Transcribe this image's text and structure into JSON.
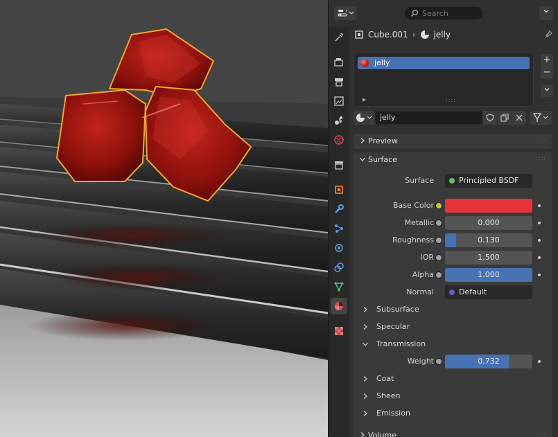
{
  "topbar": {
    "search_placeholder": "Search"
  },
  "context": {
    "object_name": "Cube.001",
    "material_name": "jelly"
  },
  "material_slots": {
    "items": [
      {
        "label": "jelly",
        "selected": true
      }
    ]
  },
  "material_selector": {
    "name": "jelly"
  },
  "panels": {
    "preview": {
      "label": "Preview"
    },
    "surface": {
      "label": "Surface",
      "properties": [
        {
          "label": "Surface",
          "value": "Principled BSDF",
          "socket_color": "#63c763"
        },
        {
          "label": "Base Color",
          "value": "",
          "color": "#e8323a",
          "socket_color": "#c7c729"
        },
        {
          "label": "Metallic",
          "value": "0.000",
          "fraction": 0.0,
          "socket_color": "#a1a1a1"
        },
        {
          "label": "Roughness",
          "value": "0.130",
          "fraction": 0.13,
          "socket_color": "#a1a1a1"
        },
        {
          "label": "IOR",
          "value": "1.500",
          "fraction": 0.0,
          "socket_color": "#a1a1a1"
        },
        {
          "label": "Alpha",
          "value": "1.000",
          "fraction": 1.0,
          "socket_color": "#a1a1a1"
        },
        {
          "label": "Normal",
          "value": "Default",
          "socket_color": "#6363c7"
        }
      ],
      "subpanels": [
        {
          "label": "Subsurface",
          "open": false
        },
        {
          "label": "Specular",
          "open": false
        },
        {
          "label": "Transmission",
          "open": true
        }
      ],
      "transmission": {
        "label": "Weight",
        "value": "0.732",
        "fraction": 0.732,
        "socket_color": "#a1a1a1"
      },
      "subpanels_after": [
        {
          "label": "Coat",
          "open": false
        },
        {
          "label": "Sheen",
          "open": false
        },
        {
          "label": "Emission",
          "open": false
        }
      ]
    },
    "volume": {
      "label": "Volume"
    }
  }
}
